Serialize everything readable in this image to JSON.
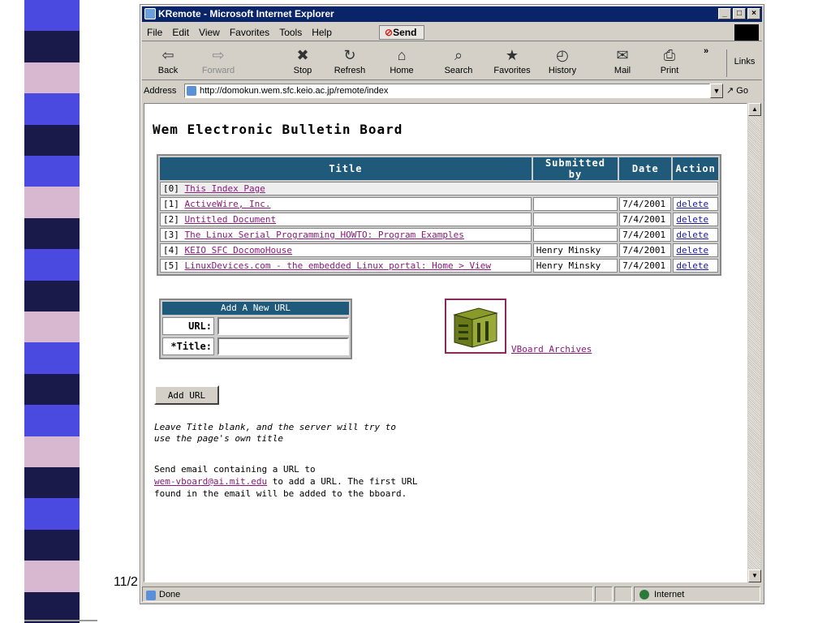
{
  "window": {
    "title": "KRemote - Microsoft Internet Explorer",
    "min_glyph": "_",
    "max_glyph": "□",
    "close_glyph": "×"
  },
  "menu": {
    "items": [
      "File",
      "Edit",
      "View",
      "Favorites",
      "Tools",
      "Help"
    ],
    "send_label": "Send"
  },
  "toolbar": {
    "back": {
      "label": "Back",
      "icon": "⇦"
    },
    "forward": {
      "label": "Forward",
      "icon": "⇨"
    },
    "stop": {
      "label": "Stop",
      "icon": "✖"
    },
    "refresh": {
      "label": "Refresh",
      "icon": "↻"
    },
    "home": {
      "label": "Home",
      "icon": "⌂"
    },
    "search": {
      "label": "Search",
      "icon": "⌕"
    },
    "favorites": {
      "label": "Favorites",
      "icon": "★"
    },
    "history": {
      "label": "History",
      "icon": "◴"
    },
    "mail": {
      "label": "Mail",
      "icon": "✉"
    },
    "print": {
      "label": "Print",
      "icon": "⎙"
    },
    "chevron": "»",
    "links_label": "Links"
  },
  "address": {
    "label": "Address",
    "url": "http://domokun.wem.sfc.keio.ac.jp/remote/index",
    "go_label": "Go"
  },
  "page": {
    "title": "Wem Electronic Bulletin Board",
    "table": {
      "headers": [
        "Title",
        "Submitted by",
        "Date",
        "Action"
      ],
      "rows": [
        {
          "index": "[0]",
          "title": "This Index Page",
          "submitted_by": "",
          "date": "",
          "action": ""
        },
        {
          "index": "[1]",
          "title": "ActiveWire, Inc.",
          "submitted_by": "",
          "date": "7/4/2001",
          "action": "delete"
        },
        {
          "index": "[2]",
          "title": "Untitled Document",
          "submitted_by": "",
          "date": "7/4/2001",
          "action": "delete"
        },
        {
          "index": "[3]",
          "title": "The Linux Serial Programming HOWTO: Program Examples",
          "submitted_by": "",
          "date": "7/4/2001",
          "action": "delete"
        },
        {
          "index": "[4]",
          "title": "KEIO SFC DocomoHouse",
          "submitted_by": "Henry Minsky",
          "date": "7/4/2001",
          "action": "delete"
        },
        {
          "index": "[5]",
          "title": "LinuxDevices.com - the embedded Linux portal: Home > View",
          "submitted_by": "Henry Minsky",
          "date": "7/4/2001",
          "action": "delete"
        }
      ]
    },
    "form": {
      "header": "Add A New URL",
      "url_label": "URL:",
      "title_label": "*Title:",
      "url_value": "",
      "title_value": ""
    },
    "vboard_link": "VBoard Archives",
    "add_button": "Add URL",
    "hint": "Leave Title blank, and the server will try to\nuse the page's own title",
    "email": {
      "intro": "Send email containing a URL to",
      "address": "wem-vboard@ai.mit.edu",
      "rest": " to add a URL.  The first URL found in the email will be added to the bboard."
    }
  },
  "status": {
    "text": "Done",
    "zone": "Internet"
  },
  "slide": {
    "footer": "11/2"
  },
  "colors": {
    "title_bar": "#0a246a",
    "table_header": "#1f5a7a",
    "link": "#8a1a7a",
    "stripe_blue": "#4a4ae0",
    "stripe_navy": "#1a1a4a",
    "stripe_pink": "#d8b8d0"
  }
}
